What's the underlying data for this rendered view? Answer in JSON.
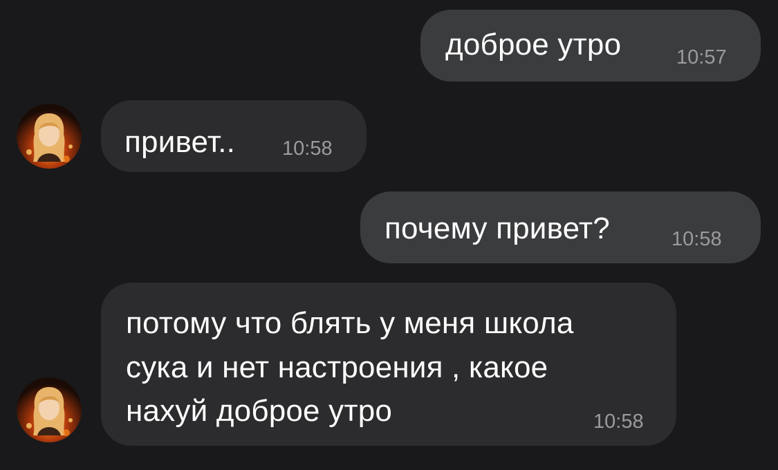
{
  "messages": [
    {
      "direction": "outgoing",
      "text": "доброе утро",
      "time": "10:57"
    },
    {
      "direction": "incoming",
      "text": "привет..",
      "time": "10:58",
      "avatar": "user-avatar"
    },
    {
      "direction": "outgoing",
      "text": "почему привет?",
      "time": "10:58"
    },
    {
      "direction": "incoming",
      "lines": [
        "потому что блять у меня школа",
        "сука и нет настроения , какое",
        "нахуй доброе утро"
      ],
      "time": "10:58",
      "avatar": "user-avatar"
    }
  ],
  "colors": {
    "background": "#19191b",
    "incoming_bubble": "#2c2c2e",
    "outgoing_bubble": "#3b3c3e",
    "text": "#ffffff",
    "time": "#9b9b9f"
  }
}
